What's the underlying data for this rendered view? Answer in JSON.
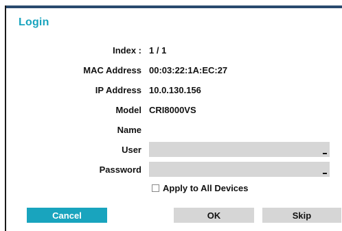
{
  "dialog": {
    "title": "Login",
    "index_label": "Index :",
    "index_value": "1 / 1",
    "mac_label": "MAC Address",
    "mac_value": "00:03:22:1A:EC:27",
    "ip_label": "IP Address",
    "ip_value": "10.0.130.156",
    "model_label": "Model",
    "model_value": "CRI8000VS",
    "name_label": "Name",
    "name_value": "",
    "user_label": "User",
    "user_value": "",
    "password_label": "Password",
    "password_value": "",
    "apply_all_label": "Apply to All Devices",
    "apply_all_checked": false
  },
  "buttons": {
    "cancel": "Cancel",
    "ok": "OK",
    "skip": "Skip"
  },
  "colors": {
    "accent": "#19a4be",
    "field_bg": "#d6d6d6",
    "header_bar": "#2a4a6e"
  }
}
